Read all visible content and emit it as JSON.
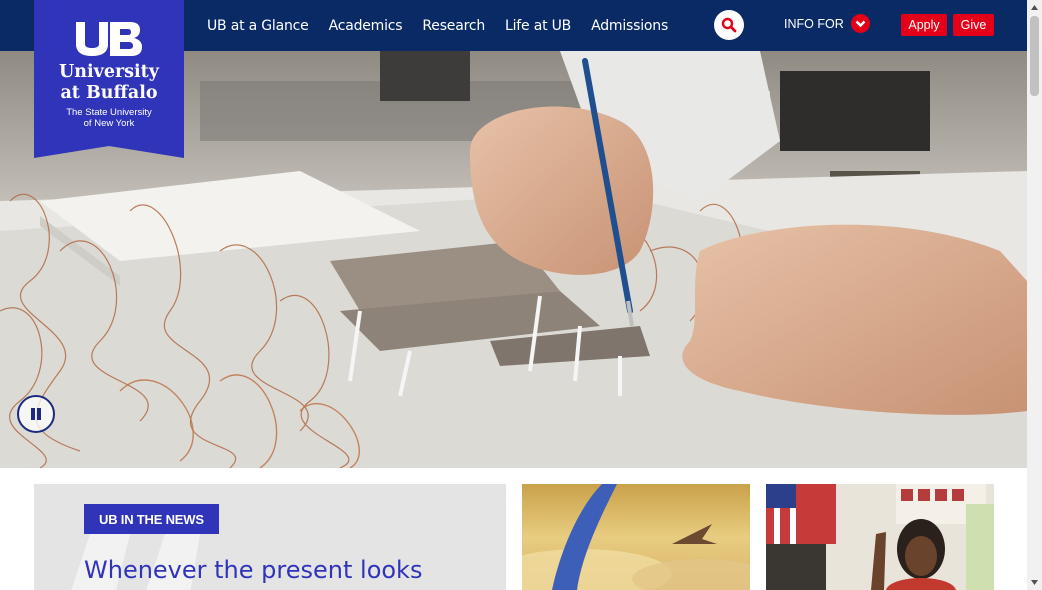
{
  "logo": {
    "university_line1": "University",
    "university_line2": "at Buffalo",
    "sub_line1": "The State University",
    "sub_line2": "of New York",
    "icon": "ub-monogram-icon"
  },
  "nav": {
    "items": [
      {
        "label": "UB at a Glance"
      },
      {
        "label": "Academics"
      },
      {
        "label": "Research"
      },
      {
        "label": "Life at UB"
      },
      {
        "label": "Admissions"
      }
    ],
    "search_icon": "search-icon",
    "info_for_label": "INFO FOR",
    "info_for_icon": "chevron-down-icon",
    "apply_label": "Apply",
    "give_label": "Give"
  },
  "hero": {
    "image": "architecture-model-photo",
    "pause_icon": "pause-icon"
  },
  "news": {
    "badge": "UB IN THE NEWS",
    "quote": "Whenever the present looks"
  },
  "cards": [
    {
      "image": "airplane-in-sunset-photo"
    },
    {
      "image": "teacher-in-classroom-photo"
    }
  ],
  "colors": {
    "navy": "#0a2a66",
    "ub_blue": "#2f34b8",
    "red": "#e5001a"
  }
}
